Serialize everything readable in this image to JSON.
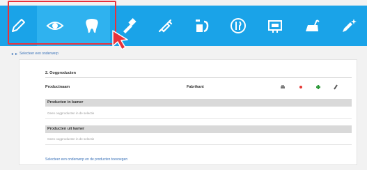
{
  "toolbar": {
    "tools": [
      {
        "icon": "pencil-icon",
        "active": false
      },
      {
        "icon": "eye-icon",
        "active": true
      },
      {
        "icon": "tooth-icon",
        "active": true
      },
      {
        "icon": "brush-icon",
        "active": false
      },
      {
        "icon": "syringe-icon",
        "active": false
      },
      {
        "icon": "cup-brush-icon",
        "active": false
      },
      {
        "icon": "fork-knife-icon",
        "active": false
      },
      {
        "icon": "picture-icon",
        "active": false
      },
      {
        "icon": "tv-toy-icon",
        "active": false
      },
      {
        "icon": "pencil-sparkle-icon",
        "active": false
      }
    ],
    "colors": {
      "bar": "#1aa3e8",
      "active": "#2fb2ef",
      "icon": "#ffffff"
    }
  },
  "highlight": {
    "color": "#e8323c"
  },
  "breadcrumb": {
    "text": "Selecteer een onderwerp"
  },
  "section": {
    "title": "2. Oogproducten"
  },
  "table": {
    "col_product": "Productnaam",
    "col_brand": "Fabrikant",
    "groups": [
      {
        "title": "Producten in kamer",
        "empty": "Geen oogproducten in de selectie"
      },
      {
        "title": "Producten uit kamer",
        "empty": "Geen oogproducten in de selectie"
      }
    ]
  },
  "footer_link": "Selecteer een onderwerp en de producten toevoegen"
}
